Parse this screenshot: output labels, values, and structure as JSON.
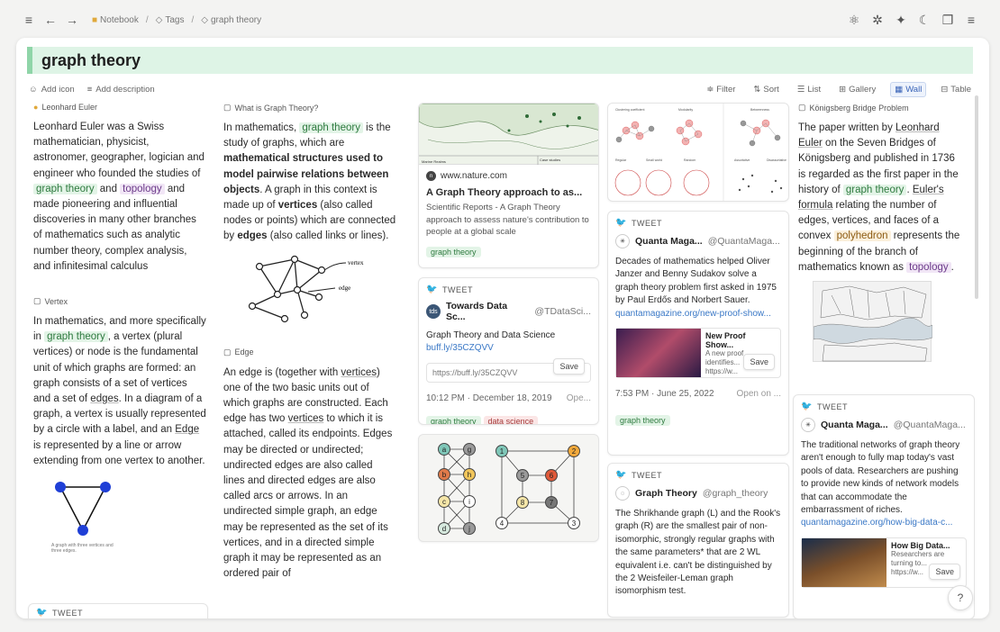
{
  "breadcrumb": {
    "notebook": "Notebook",
    "tags": "Tags",
    "current": "graph theory"
  },
  "page": {
    "title": "graph theory"
  },
  "toolbar": {
    "add_icon": "Add icon",
    "add_description": "Add description",
    "filter": "Filter",
    "sort": "Sort",
    "views": [
      "List",
      "Gallery",
      "Wall",
      "Table"
    ],
    "active_view": "Wall"
  },
  "col1": {
    "euler_title": "Leonhard Euler",
    "euler_body": [
      "Leonhard Euler was a Swiss mathematician, physicist, astronomer, geographer, logician and engineer who founded the studies of ",
      "graph theory",
      " and ",
      "topology",
      " and made pioneering and influential discoveries in many other branches of mathematics such as analytic number theory, complex analysis, and infinitesimal calculus"
    ],
    "vertex_title": "Vertex",
    "vertex_body": [
      "In mathematics, and more specifically in ",
      "graph theory",
      ", a vertex (plural vertices) or node is the fundamental unit of which graphs are formed: an graph consists of a set of vertices and a set of ",
      "edges",
      ". In a diagram of a graph, a vertex is usually represented by a circle with a label, and an ",
      "Edge",
      " is represented by a line or arrow extending from one vertex to another."
    ],
    "triangle_caption": "A graph with three vertices and three edges.",
    "tweet_label": "TWEET"
  },
  "col2": {
    "what_title": "What is Graph Theory?",
    "what_body": [
      "In mathematics, ",
      "graph theory",
      " is the study of graphs, which are ",
      "mathematical structures used to model pairwise relations between objects",
      ". A graph in this context is made up of ",
      "vertices",
      " (also called nodes or points) which are connected by ",
      "edges",
      " (also called links or lines)."
    ],
    "diagram_vertex": "vertex",
    "diagram_edge": "edge",
    "edge_title": "Edge",
    "edge_body": [
      "An edge is (together with ",
      "vertices",
      ") one of the two basic units out of which graphs are constructed. Each edge has two ",
      "vertices",
      " to which it is attached, called its endpoints. Edges may be directed or undirected; undirected edges are also called lines and directed edges are also called arcs or arrows. In an undirected simple graph, an edge may be represented as the set of its vertices, and in a directed simple graph it may be represented as an ordered pair of"
    ]
  },
  "col3": {
    "map_label_left": "Marine Realms",
    "map_label_right": "Case studies",
    "nature_site": "www.nature.com",
    "nature_title": "A Graph Theory approach to as...",
    "nature_desc": "Scientific Reports - A Graph Theory approach to assess nature's contribution to people at a global scale",
    "nature_tag": "graph theory",
    "tds_label": "TWEET",
    "tds_avatar": "tds",
    "tds_name": "Towards Data Sc...",
    "tds_handle": "@TDataSci...",
    "tds_text": "Graph Theory and Data Science",
    "tds_link": "buff.ly/35CZQVV",
    "tds_preview_url": "https://buff.ly/35CZQVV",
    "tds_save": "Save",
    "tds_time": "10:12 PM · December 18, 2019",
    "tds_open": "Ope...",
    "tds_tags": [
      "graph theory",
      "data science"
    ],
    "graph_left_nodes": [
      "a",
      "g",
      "b",
      "h",
      "c",
      "i",
      "d",
      "j"
    ],
    "graph_right_nodes": [
      "1",
      "2",
      "5",
      "6",
      "8",
      "7",
      "4",
      "3"
    ]
  },
  "col4": {
    "panel_labels": [
      "Clustering coefficient",
      "Modularity",
      "Betweenness",
      "Regular",
      "Small world",
      "Random",
      "Assortative",
      "Disassortative"
    ],
    "q1_label": "TWEET",
    "q1_name": "Quanta Maga...",
    "q1_handle": "@QuantaMaga...",
    "q1_text": "Decades of mathematics helped Oliver Janzer and Benny Sudakov solve a graph theory problem first asked in 1975 by Paul Erdős and Norbert Sauer.",
    "q1_link": "quantamagazine.org/new-proof-show...",
    "q1_preview_title": "New Proof Show...",
    "q1_preview_desc": "A new proof identifies...",
    "q1_preview_url": "https://w...",
    "q1_save": "Save",
    "q1_time": "7:53 PM · June 25, 2022",
    "q1_open": "Open on ...",
    "q1_tag": "graph theory",
    "g_label": "TWEET",
    "g_name": "Graph Theory",
    "g_handle": "@graph_theory",
    "g_text": "The Shrikhande graph (L) and the Rook's graph (R) are the smallest pair of non-isomorphic, strongly regular graphs with the same parameters* that are 2 WL equivalent i.e. can't be distinguished by the 2 Weisfeiler-Leman graph isomorphism test."
  },
  "col5": {
    "konig_title": "Königsberg Bridge Problem",
    "konig_body": [
      "The paper written by ",
      "Leonhard Euler",
      " on the Seven Bridges of Königsberg and published in 1736 is regarded as the first paper in the history of ",
      "graph theory",
      ". ",
      "Euler's formula",
      " relating the number of edges, vertices, and faces of a convex ",
      "polyhedron",
      " represents the beginning of the branch of mathematics known as ",
      "topology",
      "."
    ],
    "q2_label": "TWEET",
    "q2_name": "Quanta Maga...",
    "q2_handle": "@QuantaMaga...",
    "q2_text": "The traditional networks of graph theory aren't enough to fully map today's vast pools of data. Researchers are pushing to provide new kinds of network models that can accommodate the embarrassment of riches.",
    "q2_link": "quantamagazine.org/how-big-data-c...",
    "q2_preview_title": "How Big Data...",
    "q2_preview_desc": "Researchers are turning to...",
    "q2_preview_url": "https://w...",
    "q2_save": "Save"
  },
  "help": "?"
}
